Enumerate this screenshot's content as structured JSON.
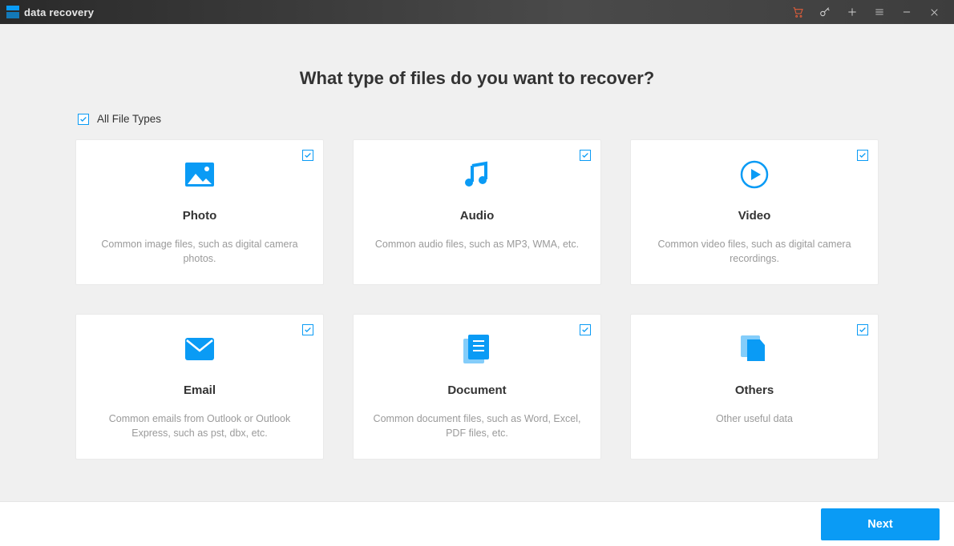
{
  "app": {
    "title": "data recovery"
  },
  "heading": "What type of files do you want to recover?",
  "all_files": {
    "label": "All File Types",
    "checked": true
  },
  "cards": [
    {
      "key": "photo",
      "title": "Photo",
      "desc": "Common image files, such as digital camera photos.",
      "checked": true
    },
    {
      "key": "audio",
      "title": "Audio",
      "desc": "Common audio files, such as MP3, WMA, etc.",
      "checked": true
    },
    {
      "key": "video",
      "title": "Video",
      "desc": "Common video files, such as digital camera recordings.",
      "checked": true
    },
    {
      "key": "email",
      "title": "Email",
      "desc": "Common emails from Outlook or Outlook Express, such as pst, dbx, etc.",
      "checked": true
    },
    {
      "key": "document",
      "title": "Document",
      "desc": "Common document files, such as Word, Excel, PDF files, etc.",
      "checked": true
    },
    {
      "key": "others",
      "title": "Others",
      "desc": "Other useful data",
      "checked": true
    }
  ],
  "footer": {
    "next": "Next"
  },
  "colors": {
    "accent": "#0a9bf5"
  }
}
